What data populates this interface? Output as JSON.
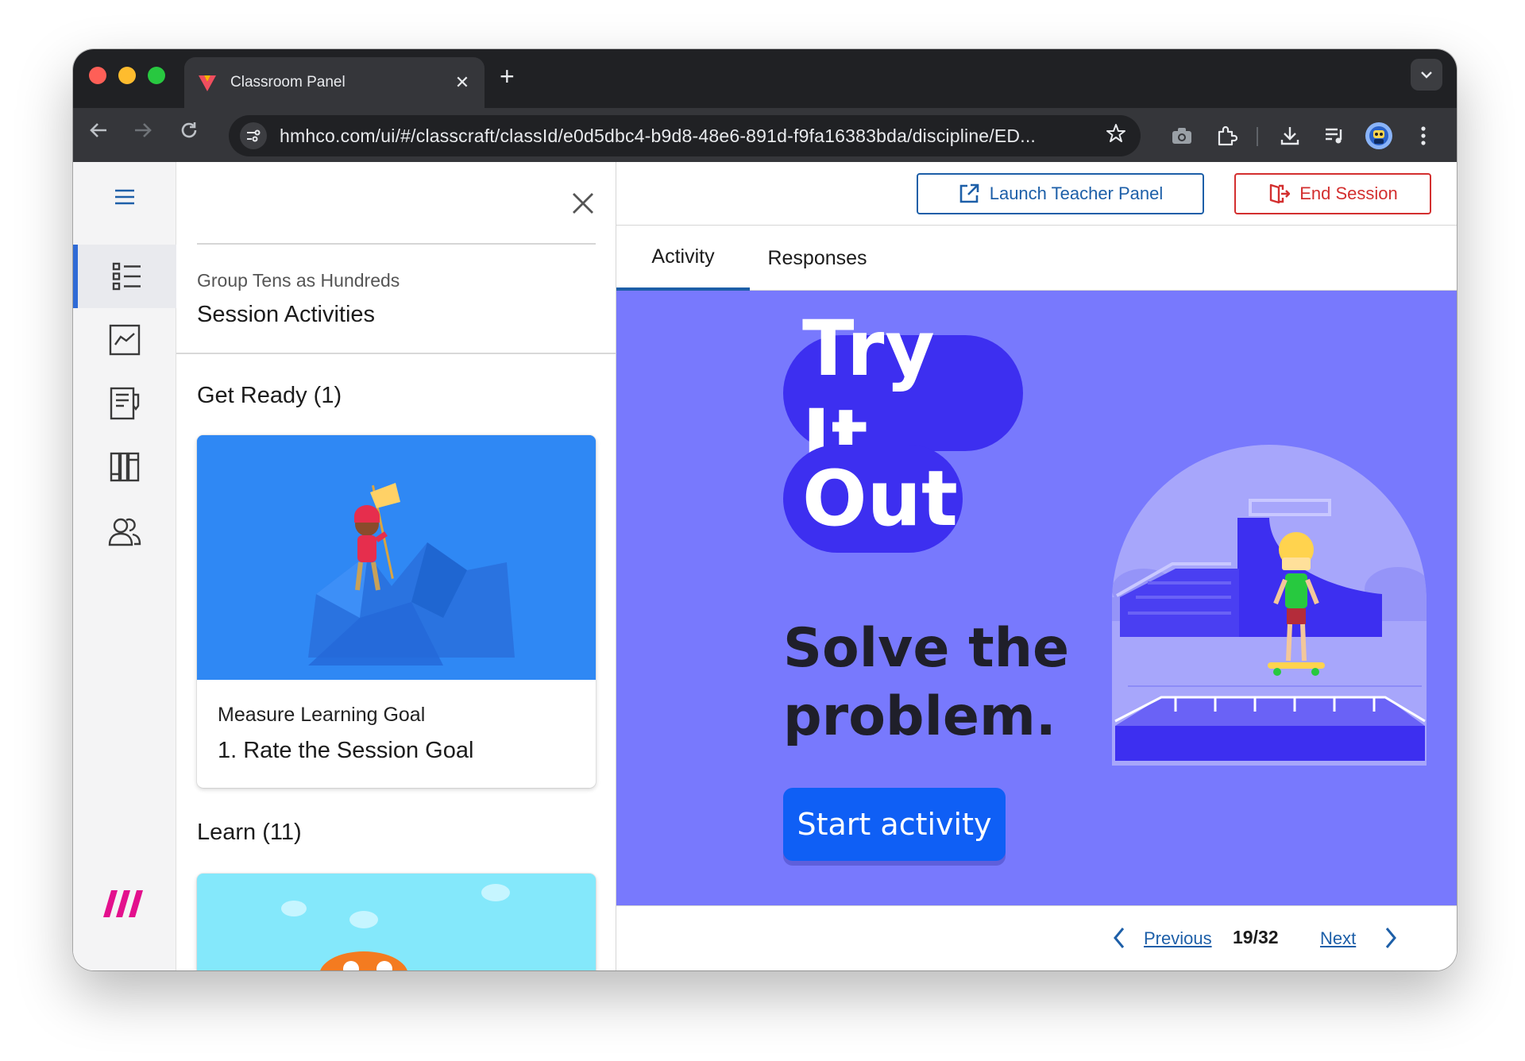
{
  "browser": {
    "tab_title": "Classroom Panel",
    "tab_close": "✕",
    "new_tab": "+",
    "url": "hmhco.com/ui/#/classcraft/classId/e0d5dbc4-b9d8-48e6-891d-f9fa16383bda/discipline/ED..."
  },
  "drawer": {
    "subtitle": "Group Tens as Hundreds",
    "title": "Session Activities",
    "sections": [
      {
        "heading": "Get Ready (1)",
        "card": {
          "type": "Measure Learning Goal",
          "name": "1. Rate the Session Goal"
        }
      },
      {
        "heading": "Learn (11)"
      }
    ]
  },
  "header": {
    "launch_label": "Launch Teacher Panel",
    "end_label": "End Session"
  },
  "tabs": [
    {
      "label": "Activity",
      "active": true
    },
    {
      "label": "Responses",
      "active": false
    }
  ],
  "activity": {
    "title_line1": "Try It",
    "title_line2": "Out",
    "prompt_line1": "Solve the",
    "prompt_line2": "problem.",
    "start_label": "Start activity"
  },
  "pager": {
    "previous_label": "Previous",
    "count": "19/32",
    "next_label": "Next"
  },
  "colors": {
    "accent_blue": "#1d5fa8",
    "end_red": "#d32f2f",
    "stage_purple": "#7879fd",
    "pill_indigo": "#3d2ff0",
    "start_blue": "#0f5ff5"
  },
  "icons": {
    "rail": [
      "menu-icon",
      "activities-list-icon",
      "chart-icon",
      "notes-icon",
      "library-icon",
      "students-icon"
    ],
    "toolbar": [
      "back-icon",
      "forward-icon",
      "reload-icon",
      "site-settings-icon",
      "star-icon",
      "camera-icon",
      "extensions-icon",
      "download-icon",
      "media-icon",
      "profile-icon",
      "menu-dots-icon"
    ]
  }
}
